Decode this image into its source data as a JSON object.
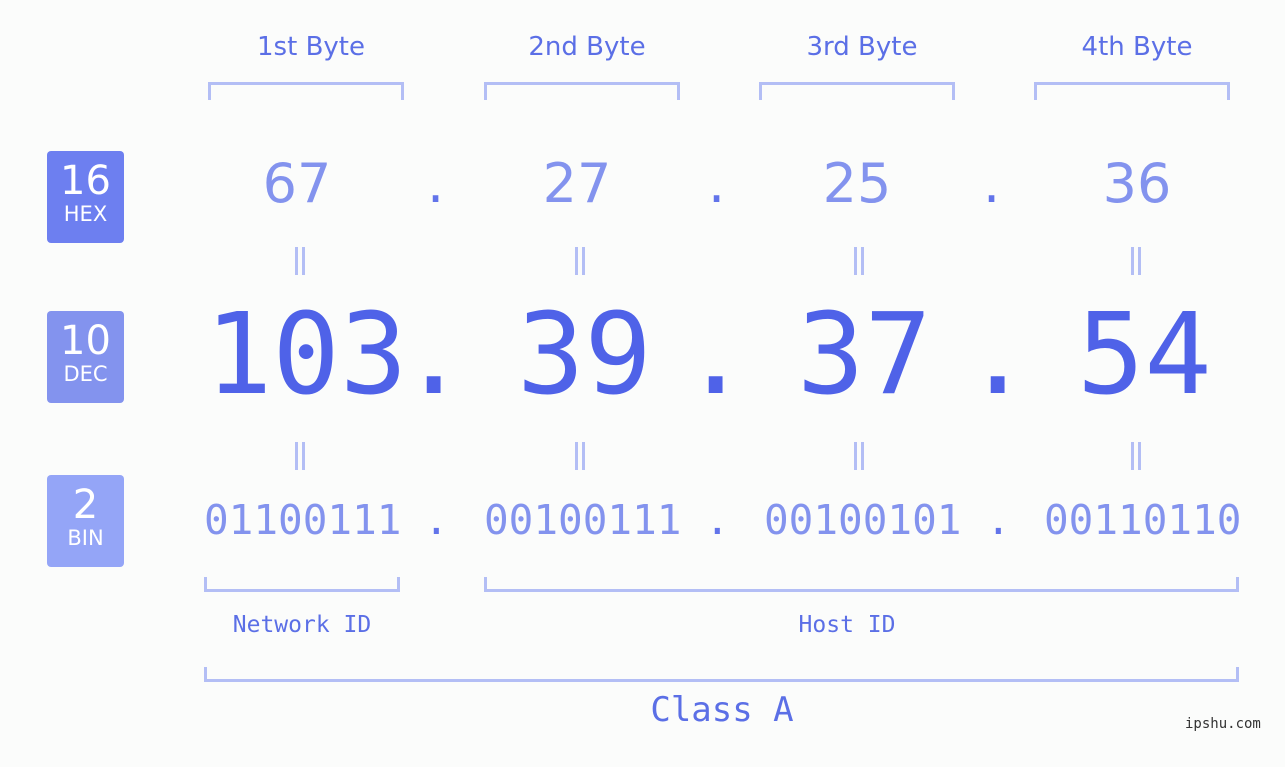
{
  "bases": [
    {
      "number": "16",
      "label": "HEX",
      "color": "#6d7ff0"
    },
    {
      "number": "10",
      "label": "DEC",
      "color": "#8393ee"
    },
    {
      "number": "2",
      "label": "BIN",
      "color": "#94a5f7"
    }
  ],
  "byte_headers": [
    "1st Byte",
    "2nd Byte",
    "3rd Byte",
    "4th Byte"
  ],
  "hex": [
    "67",
    "27",
    "25",
    "36"
  ],
  "dec": [
    "103",
    "39",
    "37",
    "54"
  ],
  "bin": [
    "01100111",
    "00100111",
    "00100101",
    "00110110"
  ],
  "separator": ".",
  "equals": "=",
  "network_id_label": "Network ID",
  "host_id_label": "Host ID",
  "class_label": "Class A",
  "watermark": "ipshu.com"
}
